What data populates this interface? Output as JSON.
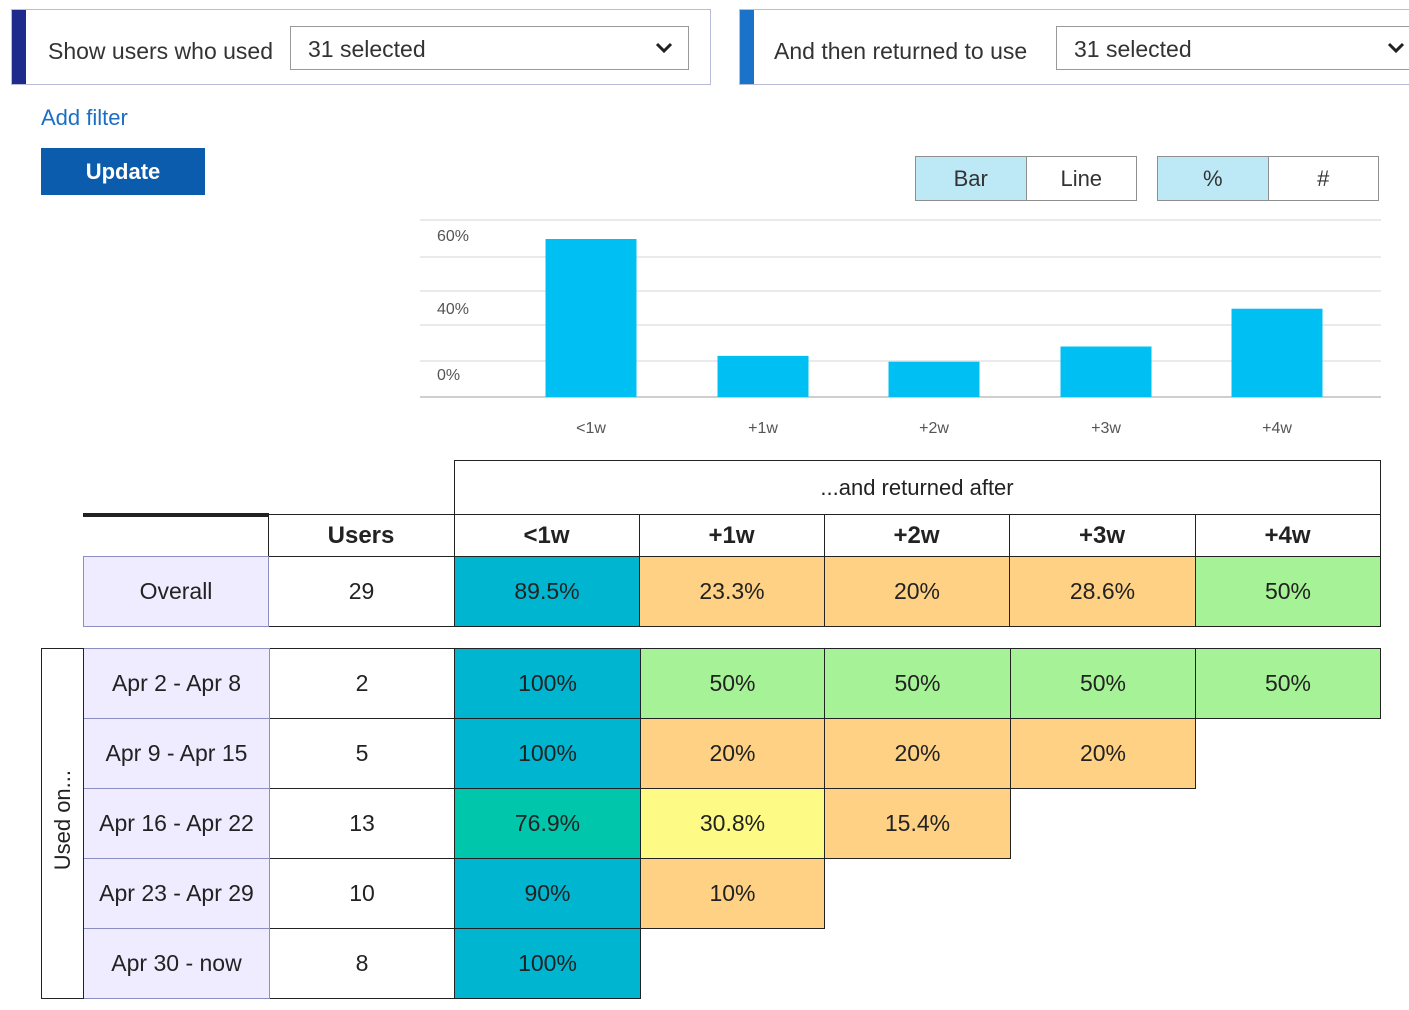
{
  "filters": {
    "first": {
      "label": "Show users who used",
      "value": "31 selected",
      "accent": "#1e2a8c"
    },
    "second": {
      "label": "And then returned to use",
      "value": "31 selected",
      "accent": "#1a73c8"
    }
  },
  "add_filter_label": "Add filter",
  "update_label": "Update",
  "chart_toggle": {
    "bar": "Bar",
    "line": "Line",
    "selected": "Bar"
  },
  "unit_toggle": {
    "percent": "%",
    "count": "#",
    "selected": "%"
  },
  "chart_data": {
    "type": "bar",
    "categories": [
      "<1w",
      "+1w",
      "+2w",
      "+3w",
      "+4w"
    ],
    "values": [
      89.5,
      23.3,
      20,
      28.6,
      50
    ],
    "y_ticks": [
      "0%",
      "40%",
      "60%"
    ],
    "color": "#00bff3"
  },
  "cohort_table": {
    "group_header": "...and returned after",
    "columns": [
      "Users",
      "<1w",
      "+1w",
      "+2w",
      "+3w",
      "+4w"
    ],
    "overall": {
      "label": "Overall",
      "users": "29",
      "cells": [
        {
          "v": "89.5%",
          "c": "#00b5d0"
        },
        {
          "v": "23.3%",
          "c": "#ffd185"
        },
        {
          "v": "20%",
          "c": "#ffd185"
        },
        {
          "v": "28.6%",
          "c": "#ffd185"
        },
        {
          "v": "50%",
          "c": "#a6f297"
        }
      ]
    },
    "row_axis_label": "Used on...",
    "rows": [
      {
        "label": "Apr 2 - Apr 8",
        "users": "2",
        "cells": [
          {
            "v": "100%",
            "c": "#00b5d0"
          },
          {
            "v": "50%",
            "c": "#a6f297"
          },
          {
            "v": "50%",
            "c": "#a6f297"
          },
          {
            "v": "50%",
            "c": "#a6f297"
          },
          {
            "v": "50%",
            "c": "#a6f297"
          }
        ]
      },
      {
        "label": "Apr 9 - Apr 15",
        "users": "5",
        "cells": [
          {
            "v": "100%",
            "c": "#00b5d0"
          },
          {
            "v": "20%",
            "c": "#ffd185"
          },
          {
            "v": "20%",
            "c": "#ffd185"
          },
          {
            "v": "20%",
            "c": "#ffd185"
          }
        ]
      },
      {
        "label": "Apr 16 - Apr 22",
        "users": "13",
        "cells": [
          {
            "v": "76.9%",
            "c": "#00c6ab"
          },
          {
            "v": "30.8%",
            "c": "#fdfb85"
          },
          {
            "v": "15.4%",
            "c": "#ffd185"
          }
        ]
      },
      {
        "label": "Apr 23 - Apr 29",
        "users": "10",
        "cells": [
          {
            "v": "90%",
            "c": "#00b5d0"
          },
          {
            "v": "10%",
            "c": "#ffd185"
          }
        ]
      },
      {
        "label": "Apr 30 - now",
        "users": "8",
        "cells": [
          {
            "v": "100%",
            "c": "#00b5d0"
          }
        ]
      }
    ]
  }
}
